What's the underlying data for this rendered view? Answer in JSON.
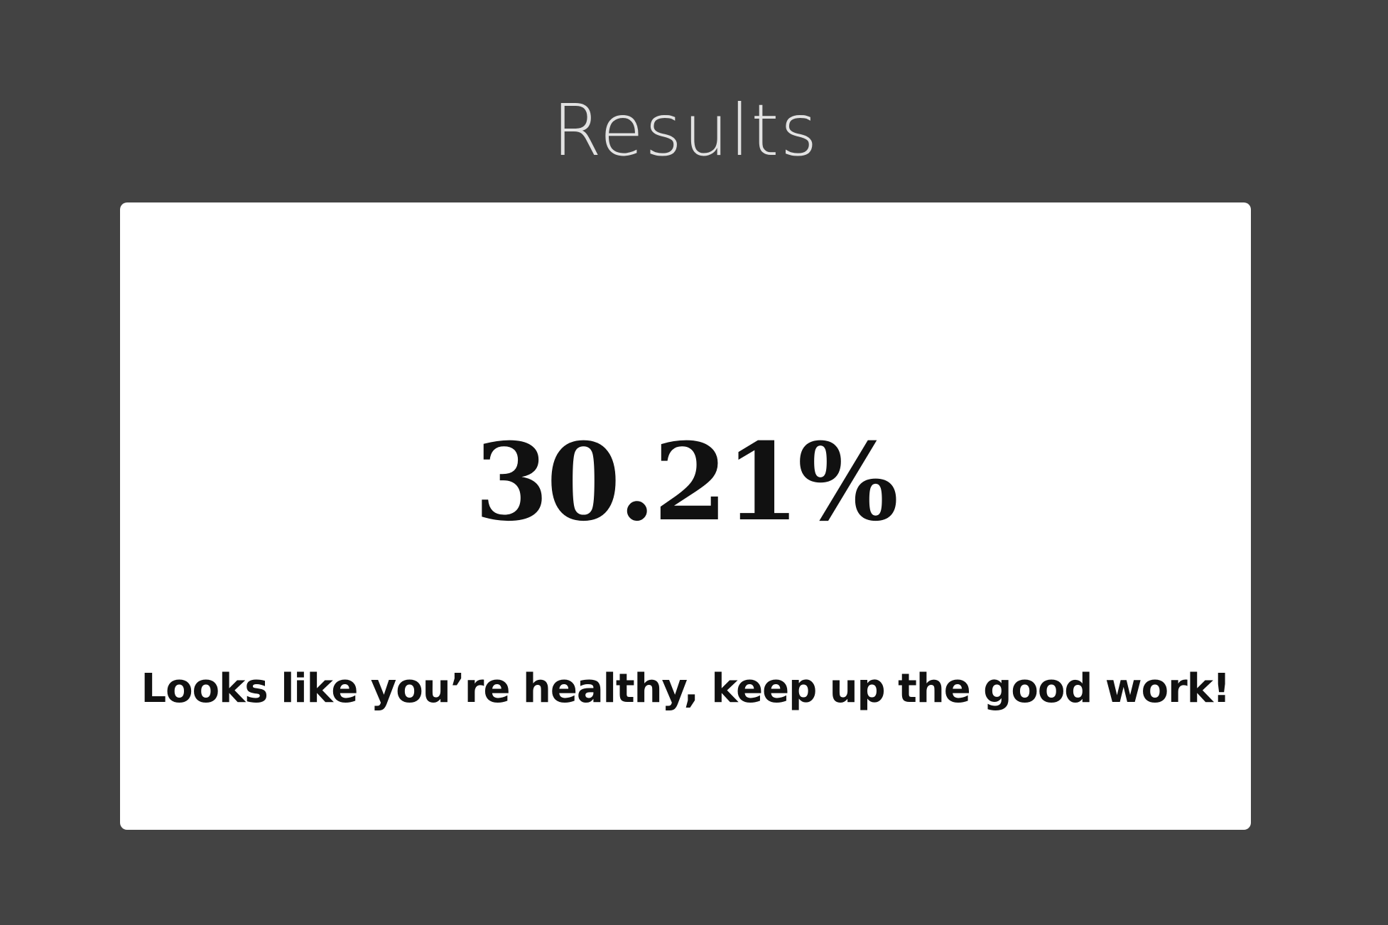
{
  "page": {
    "title": "Results"
  },
  "result": {
    "value": "30.21%",
    "message": "Looks like you’re healthy, keep up the good work!"
  },
  "colors": {
    "background": "#434343",
    "title": "#e2e2e2",
    "card": "#ffffff",
    "text": "#111111"
  }
}
